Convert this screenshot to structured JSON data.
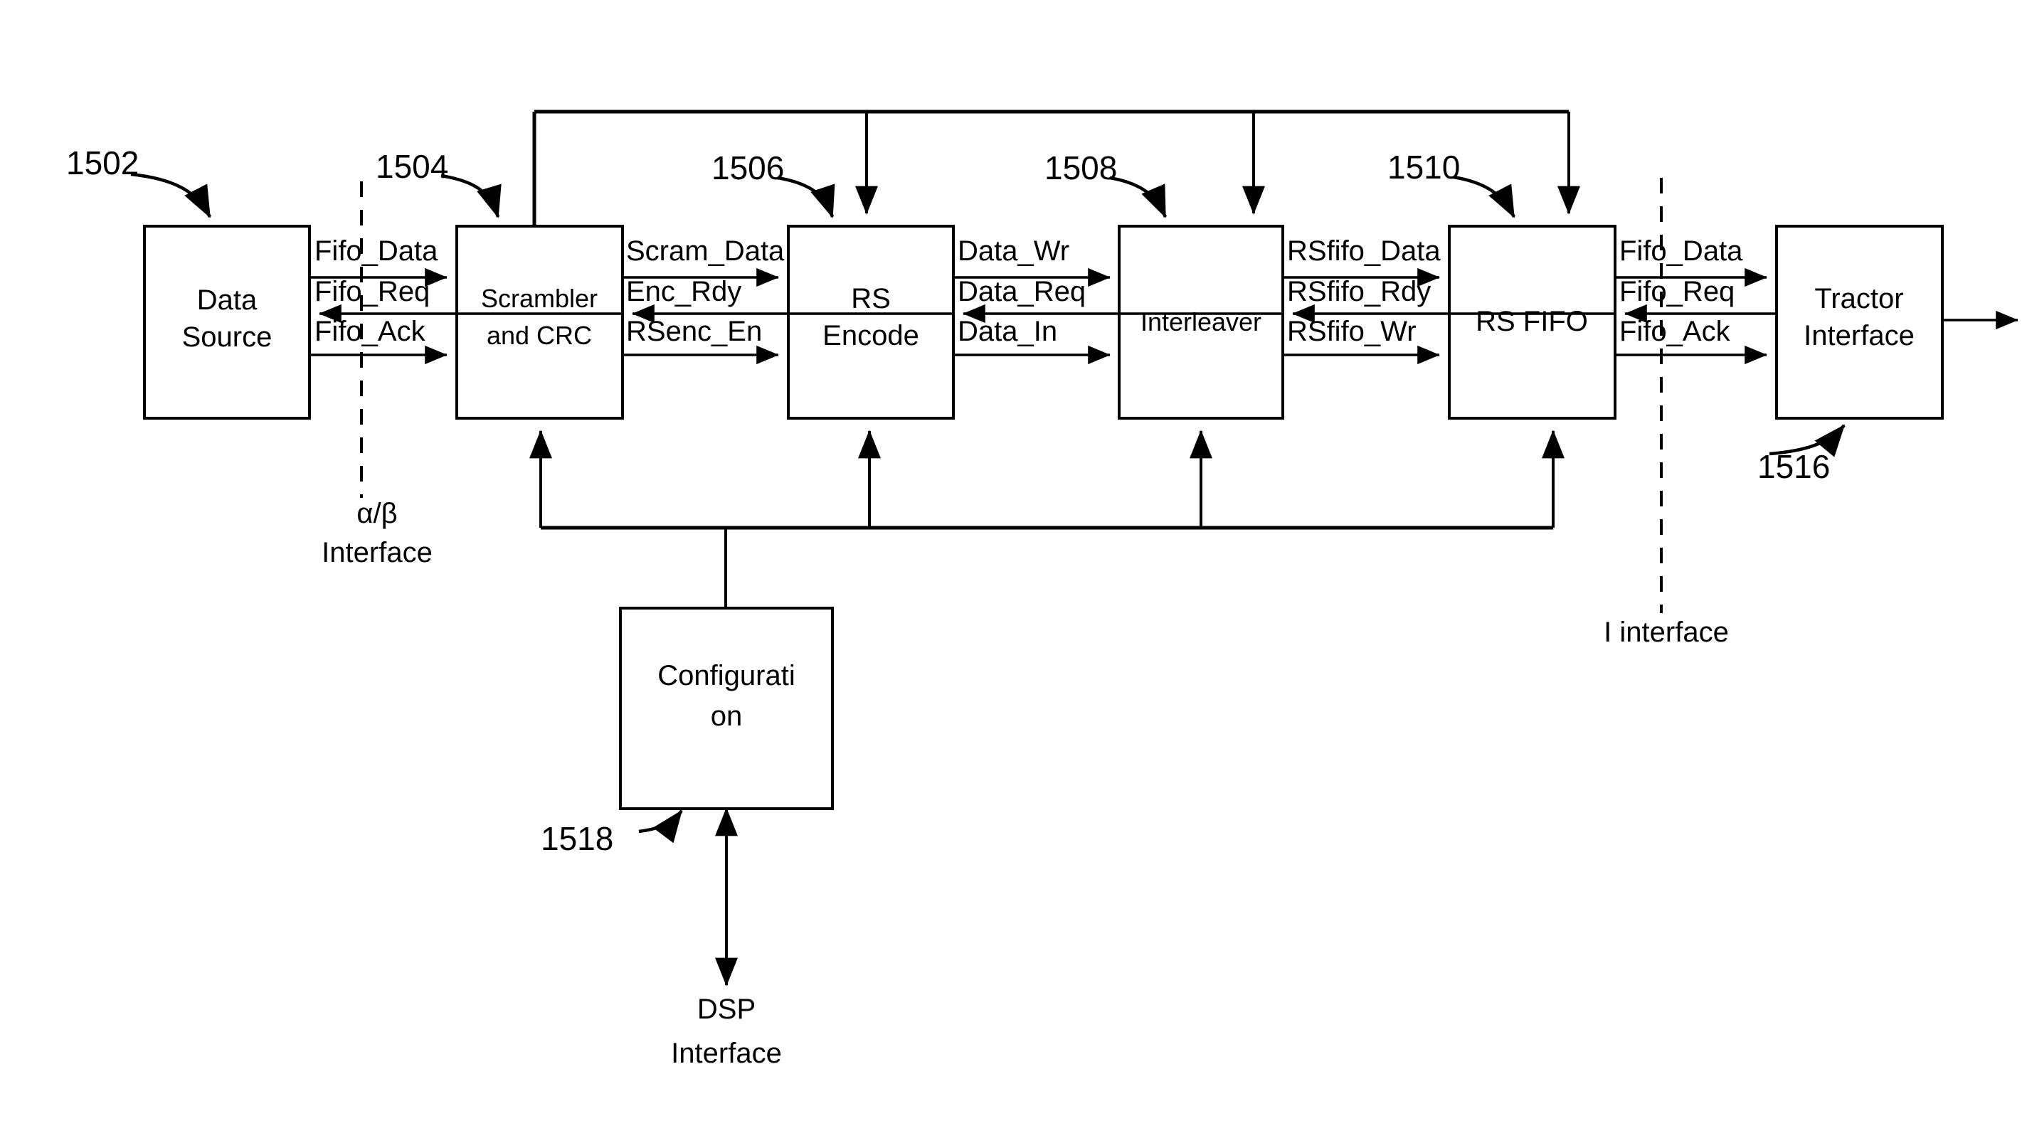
{
  "figure": {
    "blocks": [
      {
        "id": "data_source",
        "label_lines": [
          "Data",
          "Source"
        ]
      },
      {
        "id": "scrambler_crc",
        "label_lines": [
          "Scrambler",
          "and CRC"
        ]
      },
      {
        "id": "rs_encode",
        "label_lines": [
          "RS",
          "Encode"
        ]
      },
      {
        "id": "interleaver",
        "label_lines": [
          "Interleaver"
        ]
      },
      {
        "id": "rs_fifo",
        "label_lines": [
          "RS FIFO"
        ]
      },
      {
        "id": "tractor_iface",
        "label_lines": [
          "Tractor",
          "Interface"
        ]
      },
      {
        "id": "configuration",
        "label_lines": [
          "Configurati",
          "on"
        ]
      }
    ],
    "reference_numerals": [
      {
        "id": "ref_1502",
        "value": "1502",
        "points_to": "data_source"
      },
      {
        "id": "ref_1504",
        "value": "1504",
        "points_to": "scrambler_crc"
      },
      {
        "id": "ref_1506",
        "value": "1506",
        "points_to": "rs_encode"
      },
      {
        "id": "ref_1508",
        "value": "1508",
        "points_to": "interleaver"
      },
      {
        "id": "ref_1510",
        "value": "1510",
        "points_to": "rs_fifo"
      },
      {
        "id": "ref_1516",
        "value": "1516",
        "points_to": "tractor_iface"
      },
      {
        "id": "ref_1518",
        "value": "1518",
        "points_to": "configuration"
      }
    ],
    "signals": {
      "data_source_to_scrambler": [
        "Fifo_Data",
        "Fifo_Req",
        "Fifo_Ack"
      ],
      "scrambler_to_rs_encode": [
        "Scram_Data",
        "Enc_Rdy",
        "RSenc_En"
      ],
      "rs_encode_to_interleaver": [
        "Data_Wr",
        "Data_Req",
        "Data_In"
      ],
      "interleaver_to_rs_fifo": [
        "RSfifo_Data",
        "RSfifo_Rdy",
        "RSfifo_Wr"
      ],
      "rs_fifo_to_tractor": [
        "Fifo_Data",
        "Fifo_Req",
        "Fifo_Ack"
      ]
    },
    "interface_labels": {
      "alpha_beta": [
        "α/β",
        "Interface"
      ],
      "i_interface": "I interface",
      "dsp_interface": [
        "DSP",
        "Interface"
      ]
    },
    "colors": {
      "line": "#000000",
      "fill": "#ffffff",
      "background": "#ffffff"
    }
  }
}
